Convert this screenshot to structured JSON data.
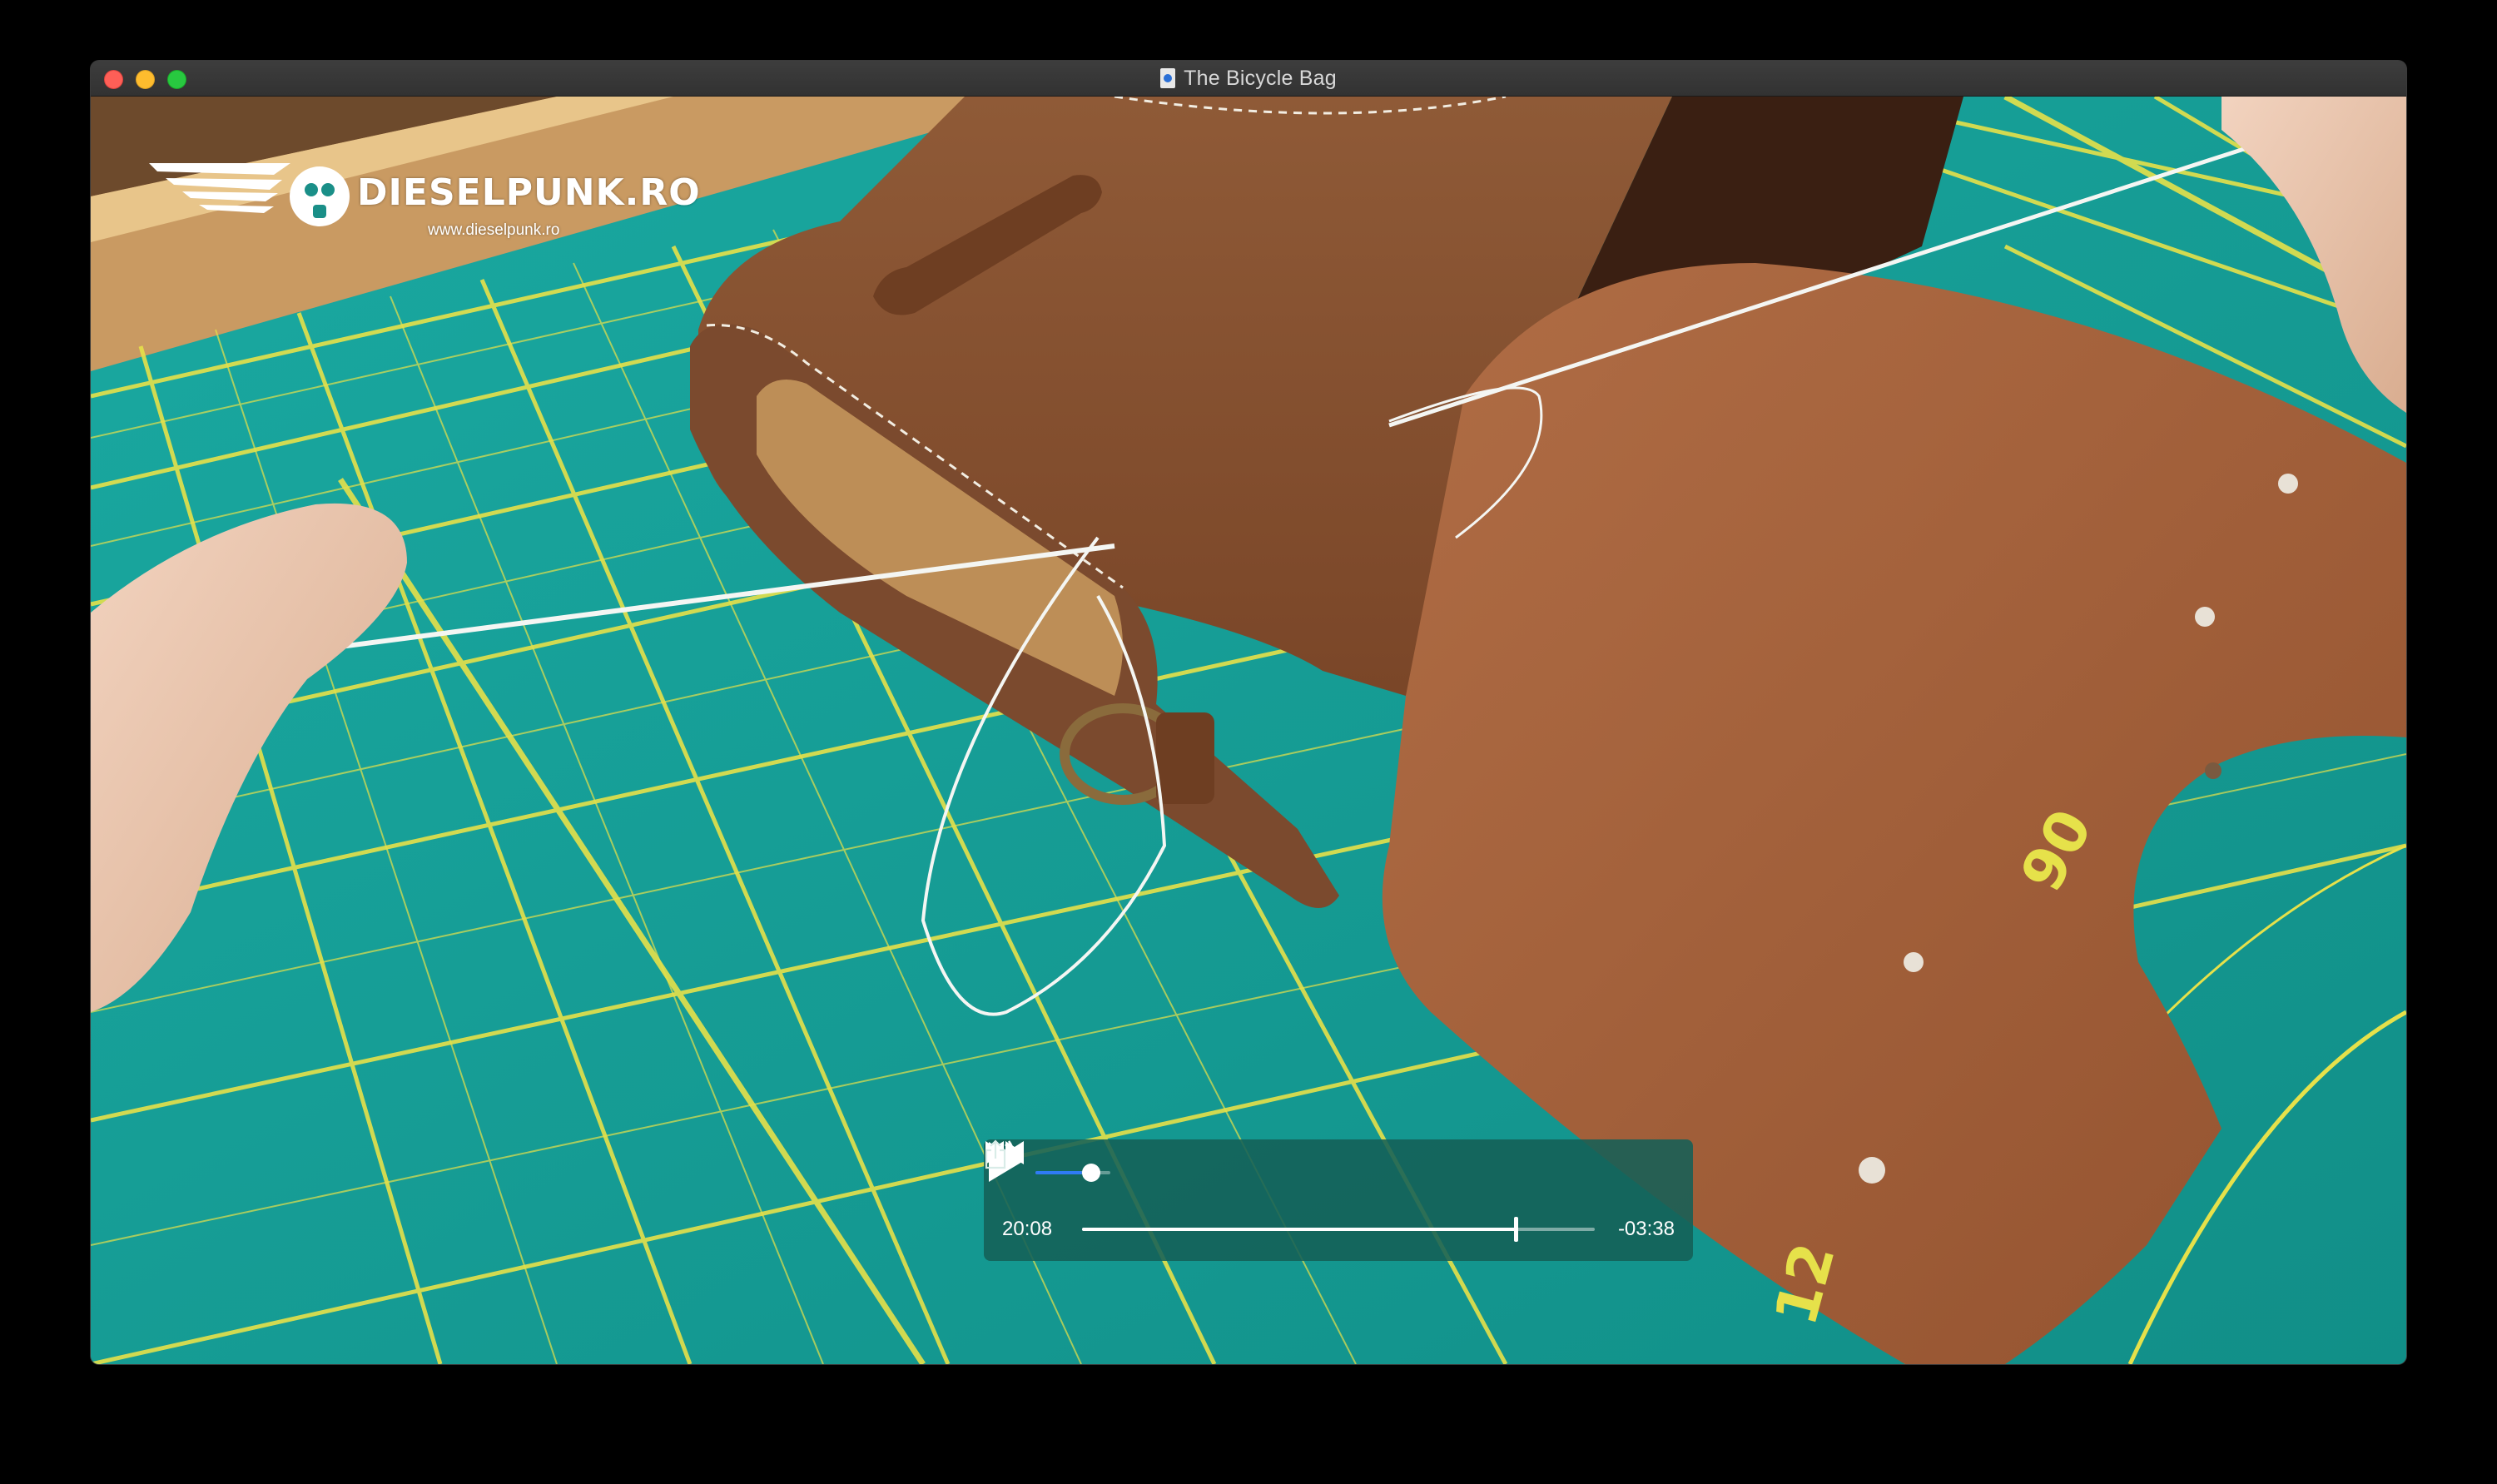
{
  "window": {
    "title": "The Bicycle Bag",
    "document_icon": "quicktime-document-icon"
  },
  "video": {
    "watermark": {
      "brand": "DIESELPUNK.RO",
      "url": "www.dieselpunk.ro",
      "logo_icon": "winged-gas-mask-logo-icon"
    },
    "cutting_mat_numbers": [
      "90",
      "12"
    ]
  },
  "player": {
    "elapsed": "20:08",
    "remaining": "-03:38",
    "progress_fraction": 0.846,
    "volume_fraction": 0.62,
    "icons": {
      "volume_low": "speaker-low-icon",
      "volume_high": "speaker-high-icon",
      "rewind": "rewind-icon",
      "play": "play-icon",
      "fast_forward": "fast-forward-icon",
      "share": "share-icon"
    }
  },
  "colors": {
    "mat": "#15a29a",
    "grid": "#e6e14a",
    "leather": "#a5623c",
    "controls_bg": "#146056",
    "volume_accent": "#2f7bf5"
  }
}
